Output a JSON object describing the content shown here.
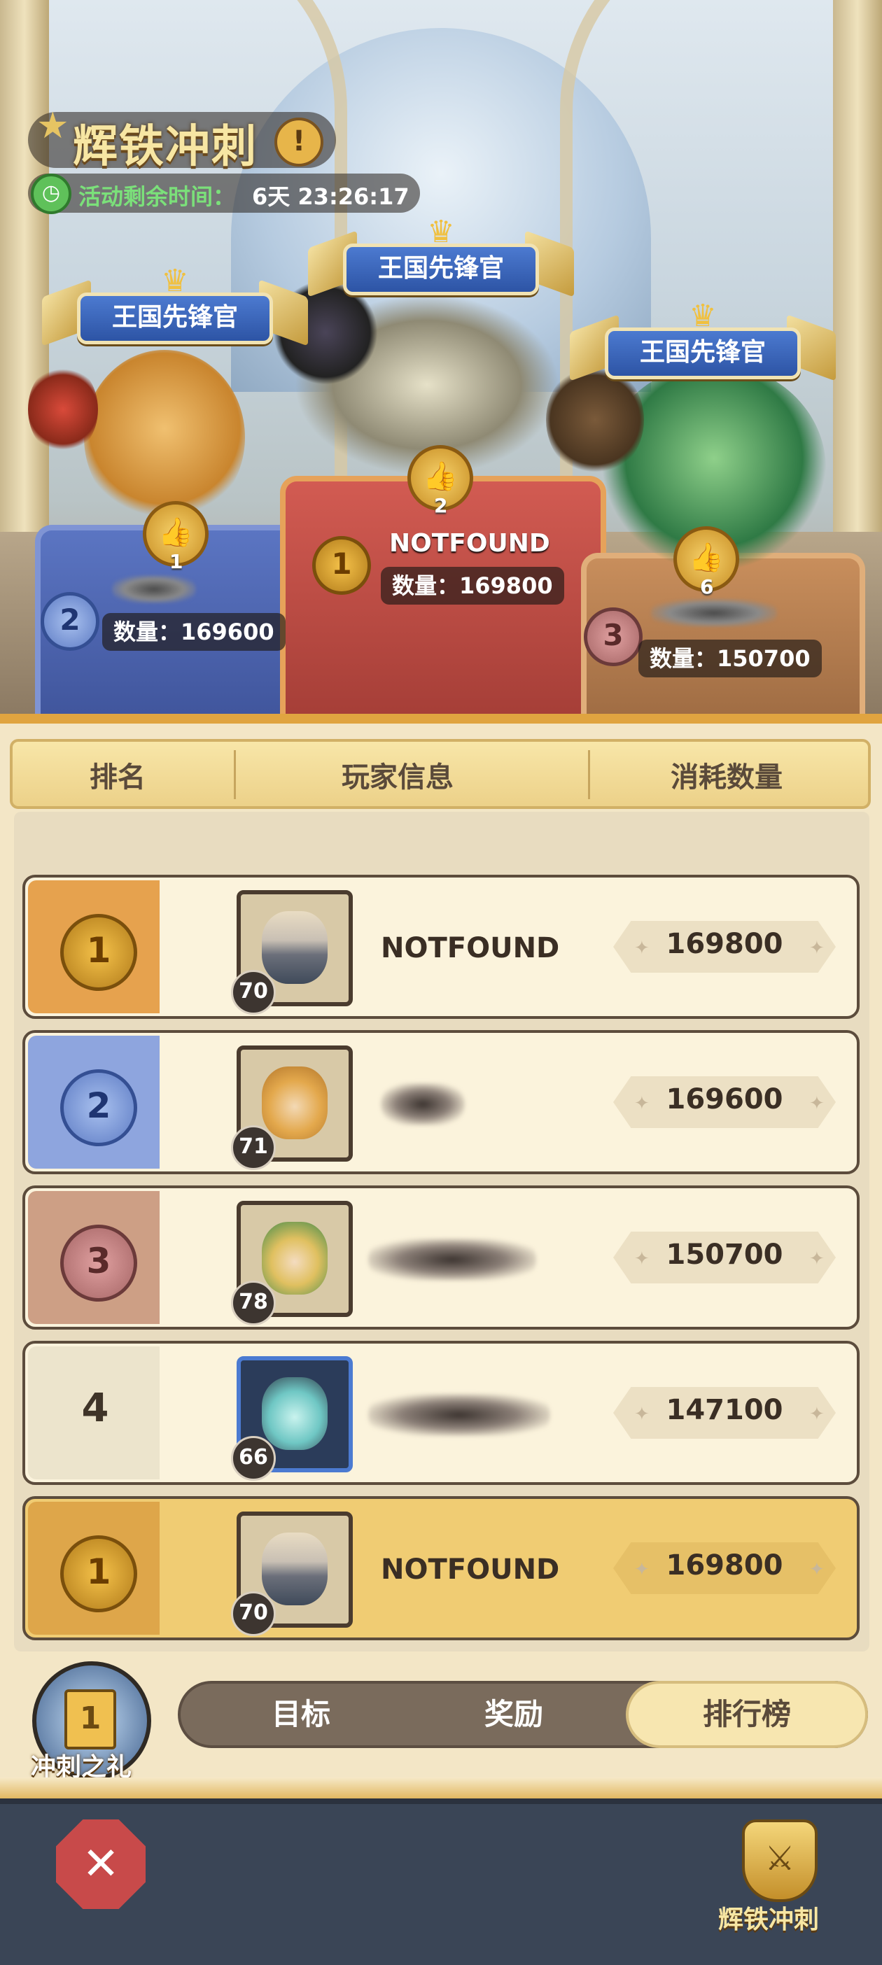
{
  "event": {
    "title": "辉铁冲刺",
    "timer_label": "活动剩余时间：",
    "timer_value": "6天 23:26:17"
  },
  "podium": [
    {
      "rank": "2",
      "banner": "王国先锋官",
      "likes": "1",
      "name": "",
      "quantity": "数量：169600"
    },
    {
      "rank": "1",
      "banner": "王国先锋官",
      "likes": "2",
      "name": "NOTFOUND",
      "quantity": "数量：169800"
    },
    {
      "rank": "3",
      "banner": "王国先锋官",
      "likes": "6",
      "name": "",
      "quantity": "数量：150700"
    }
  ],
  "table_header": {
    "rank": "排名",
    "player": "玩家信息",
    "amount": "消耗数量"
  },
  "rows": [
    {
      "rank": "1",
      "level": "70",
      "name": "NOTFOUND",
      "value": "169800"
    },
    {
      "rank": "2",
      "level": "71",
      "name": "",
      "value": "169600"
    },
    {
      "rank": "3",
      "level": "78",
      "name": "",
      "value": "150700"
    },
    {
      "rank": "4",
      "level": "66",
      "name": "",
      "value": "147100"
    }
  ],
  "self_row": {
    "rank": "1",
    "level": "70",
    "name": "NOTFOUND",
    "value": "169800"
  },
  "gift": {
    "label": "冲刺之礼",
    "icon": "1"
  },
  "tabs": [
    {
      "label": "目标",
      "active": false
    },
    {
      "label": "奖励",
      "active": false
    },
    {
      "label": "排行榜",
      "active": true
    }
  ],
  "bottom_nav": {
    "event_label": "辉铁冲刺"
  }
}
